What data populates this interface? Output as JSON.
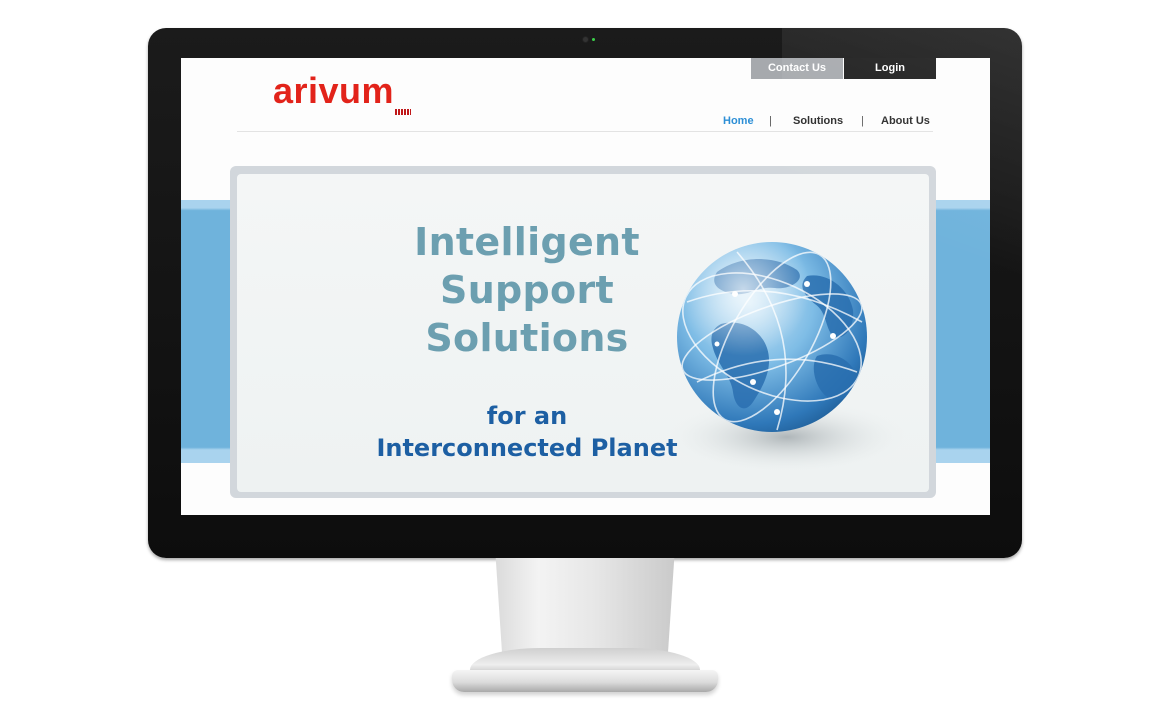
{
  "site": {
    "logo_text": "arivum",
    "top_buttons": {
      "contact": "Contact Us",
      "login": "Login"
    },
    "nav": {
      "home": "Home",
      "separator": "|",
      "solutions": "Solutions",
      "about": "About Us"
    },
    "banner": {
      "headline": [
        "Intelligent",
        "Support",
        "Solutions"
      ],
      "subline": [
        "for an",
        "Interconnected Planet"
      ]
    }
  },
  "colors": {
    "logo": "#e2231a",
    "nav_active": "#2d8fd6",
    "headline": "#6c9fb0",
    "subline": "#1d5fa3",
    "band": "#6fb3dc",
    "login_bg": "#1c1c1c",
    "contact_bg": "#a6a9ad"
  },
  "icons": {
    "globe": "globe-icon",
    "logo_mark": "flag-mark-icon"
  }
}
